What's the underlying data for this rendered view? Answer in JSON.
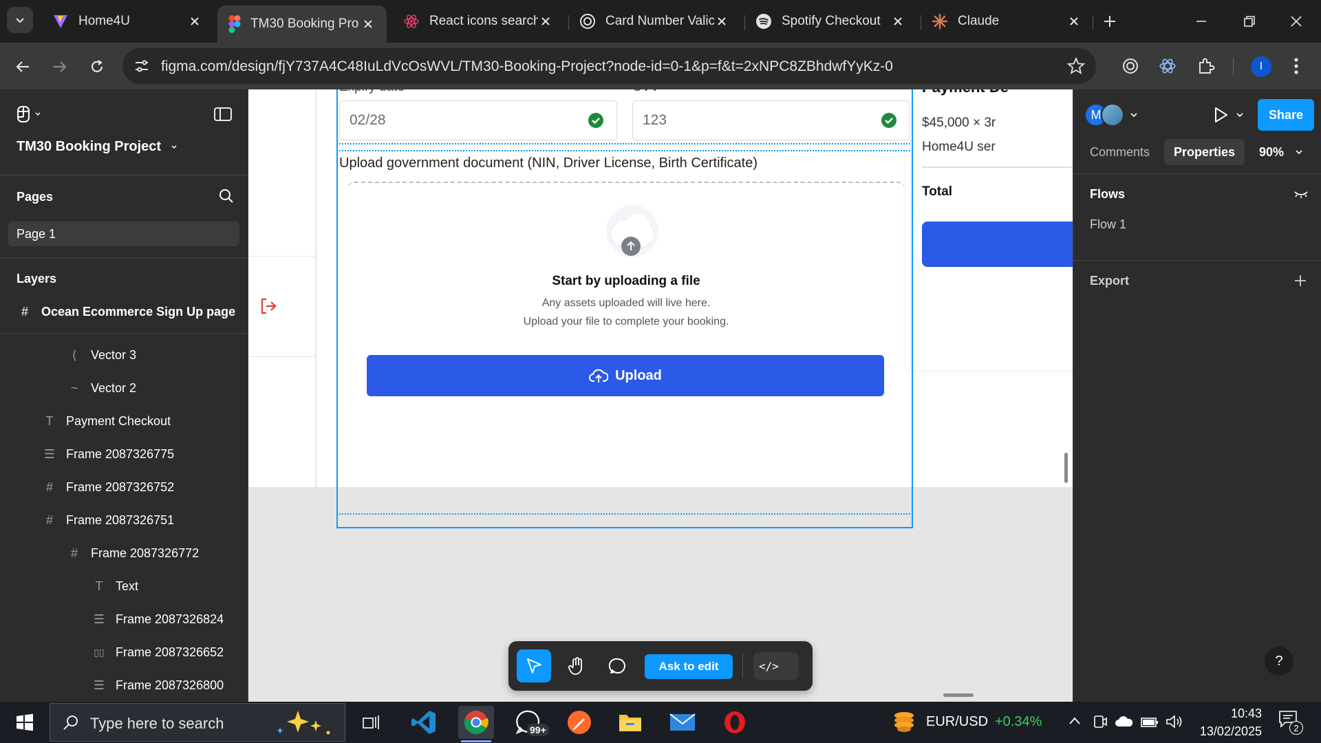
{
  "browser": {
    "tabs": [
      {
        "title": "Home4U",
        "icon": "vite-icon"
      },
      {
        "title": "TM30 Booking Pro",
        "icon": "figma-icon",
        "active": true
      },
      {
        "title": "React icons search",
        "icon": "react-icon"
      },
      {
        "title": "Card Number Valic",
        "icon": "openai-icon"
      },
      {
        "title": "Spotify Checkout",
        "icon": "spotify-icon"
      },
      {
        "title": "Claude",
        "icon": "claude-icon"
      }
    ],
    "url": "figma.com/design/fjY737A4C48IuLdVcOsWVL/TM30-Booking-Project?node-id=0-1&p=f&t=2xNPC8ZBhdwfYyKz-0",
    "profile_initial": "I"
  },
  "figma": {
    "project_title": "TM30 Booking Project",
    "pages_label": "Pages",
    "current_page": "Page 1",
    "layers_label": "Layers",
    "layers": [
      {
        "name": "Ocean Ecommerce Sign Up page",
        "icon": "#",
        "indent": 0,
        "bold": true
      },
      {
        "name": "Vector 3",
        "icon": "⟨",
        "indent": 3
      },
      {
        "name": "Vector 2",
        "icon": "~",
        "indent": 3
      },
      {
        "name": "Payment Checkout",
        "icon": "T",
        "indent": 1
      },
      {
        "name": "Frame 2087326775",
        "icon": "☰",
        "indent": 1
      },
      {
        "name": "Frame 2087326752",
        "icon": "#",
        "indent": 1
      },
      {
        "name": "Frame 2087326751",
        "icon": "#",
        "indent": 1
      },
      {
        "name": "Frame 2087326772",
        "icon": "#",
        "indent": 2
      },
      {
        "name": "Text",
        "icon": "T",
        "indent": 3
      },
      {
        "name": "Frame 2087326824",
        "icon": "☰",
        "indent": 3
      },
      {
        "name": "Frame 2087326652",
        "icon": "▯▯",
        "indent": 3
      },
      {
        "name": "Frame 2087326800",
        "icon": "☰",
        "indent": 3
      }
    ],
    "right_panel": {
      "avatar_initial": "M",
      "share_label": "Share",
      "tab_comments": "Comments",
      "tab_properties": "Properties",
      "zoom": "90%",
      "flows_label": "Flows",
      "flow_item": "Flow 1",
      "export_label": "Export",
      "help": "?"
    },
    "toolbar": {
      "ask_to_edit": "Ask to edit",
      "code_label": "</>"
    }
  },
  "design": {
    "expiry_label": "Expiry date",
    "expiry_value": "02/28",
    "cvv_label": "CVV",
    "cvv_value": "123",
    "upload_heading": "Upload government document (NIN, Driver License, Birth Certificate)",
    "upload_title": "Start by uploading a file",
    "upload_desc_1": "Any assets uploaded will live here.",
    "upload_desc_2": "Upload your file to complete your booking.",
    "upload_button": "Upload",
    "summary_title": "Payment De",
    "summary_line_1": "$45,000 × 3r",
    "summary_line_2": "Home4U ser",
    "summary_total": "Total"
  },
  "taskbar": {
    "search_placeholder": "Type here to search",
    "whatsapp_badge": "99+",
    "ticker": "EUR/USD",
    "ticker_change": "+0.34%",
    "time": "10:43",
    "date": "13/02/2025",
    "notifications": "2"
  },
  "colors": {
    "figma_blue": "#0d99ff",
    "design_blue": "#2b59e8",
    "success_green": "#1e8a3c",
    "ticker_green": "#3ccf5e"
  }
}
